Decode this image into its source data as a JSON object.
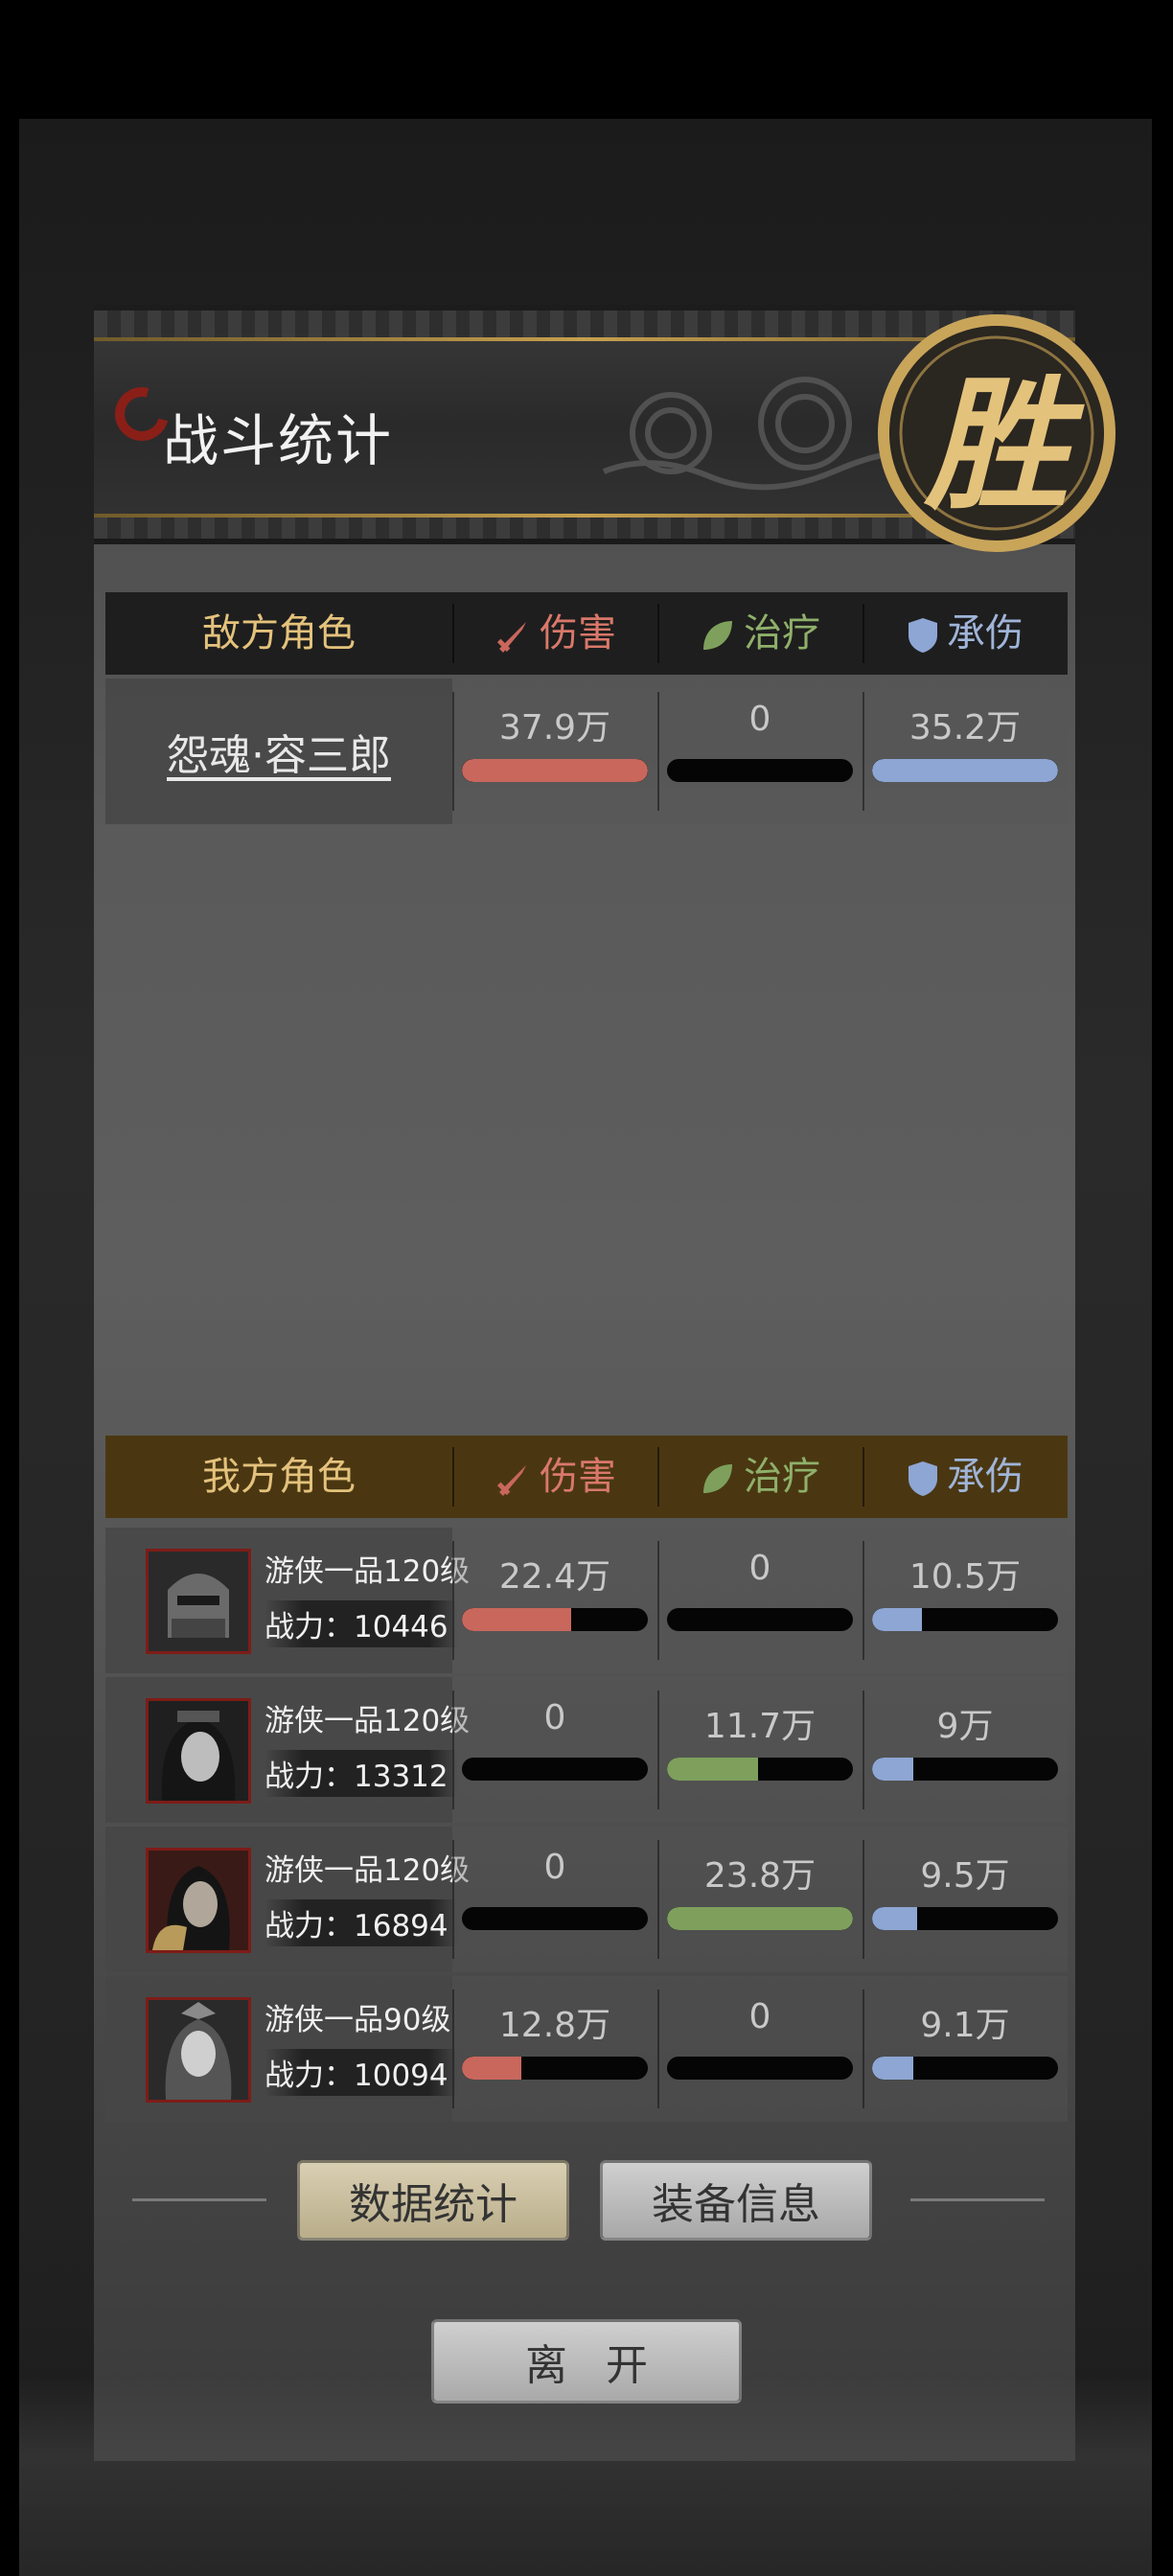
{
  "title": "战斗统计",
  "victory_glyph": "胜",
  "columns": {
    "damage": "伤害",
    "healing": "治疗",
    "tanked": "承伤"
  },
  "enemy": {
    "header": "敌方角色",
    "rows": [
      {
        "name": "怨魂·容三郎",
        "damage": "37.9万",
        "healing": "0",
        "tanked": "35.2万",
        "damage_fill": 1.0,
        "healing_fill": 0,
        "tanked_fill": 1.0
      }
    ]
  },
  "ally": {
    "header": "我方角色",
    "rows": [
      {
        "class": "游侠一品120级",
        "power_label": "战力：",
        "power": "10446",
        "damage": "22.4万",
        "healing": "0",
        "tanked": "10.5万",
        "damage_fill": 0.59,
        "healing_fill": 0,
        "tanked_fill": 0.27
      },
      {
        "class": "游侠一品120级",
        "power_label": "战力：",
        "power": "13312",
        "damage": "0",
        "healing": "11.7万",
        "tanked": "9万",
        "damage_fill": 0,
        "healing_fill": 0.49,
        "tanked_fill": 0.22
      },
      {
        "class": "游侠一品120级",
        "power_label": "战力：",
        "power": "16894",
        "damage": "0",
        "healing": "23.8万",
        "tanked": "9.5万",
        "damage_fill": 0,
        "healing_fill": 1.0,
        "tanked_fill": 0.24
      },
      {
        "class": "游侠一品90级",
        "power_label": "战力：",
        "power": "10094",
        "damage": "12.8万",
        "healing": "0",
        "tanked": "9.1万",
        "damage_fill": 0.32,
        "healing_fill": 0,
        "tanked_fill": 0.22
      }
    ]
  },
  "buttons": {
    "stats": "数据统计",
    "equipment": "装备信息",
    "leave": "离开"
  },
  "icons": {
    "damage": "sword-icon",
    "healing": "leaf-icon",
    "tanked": "shield-icon"
  },
  "colors": {
    "damage": "#c9675d",
    "healing": "#7ea05c",
    "tanked": "#8ea6d4",
    "header_gold": "#e4c27c"
  }
}
